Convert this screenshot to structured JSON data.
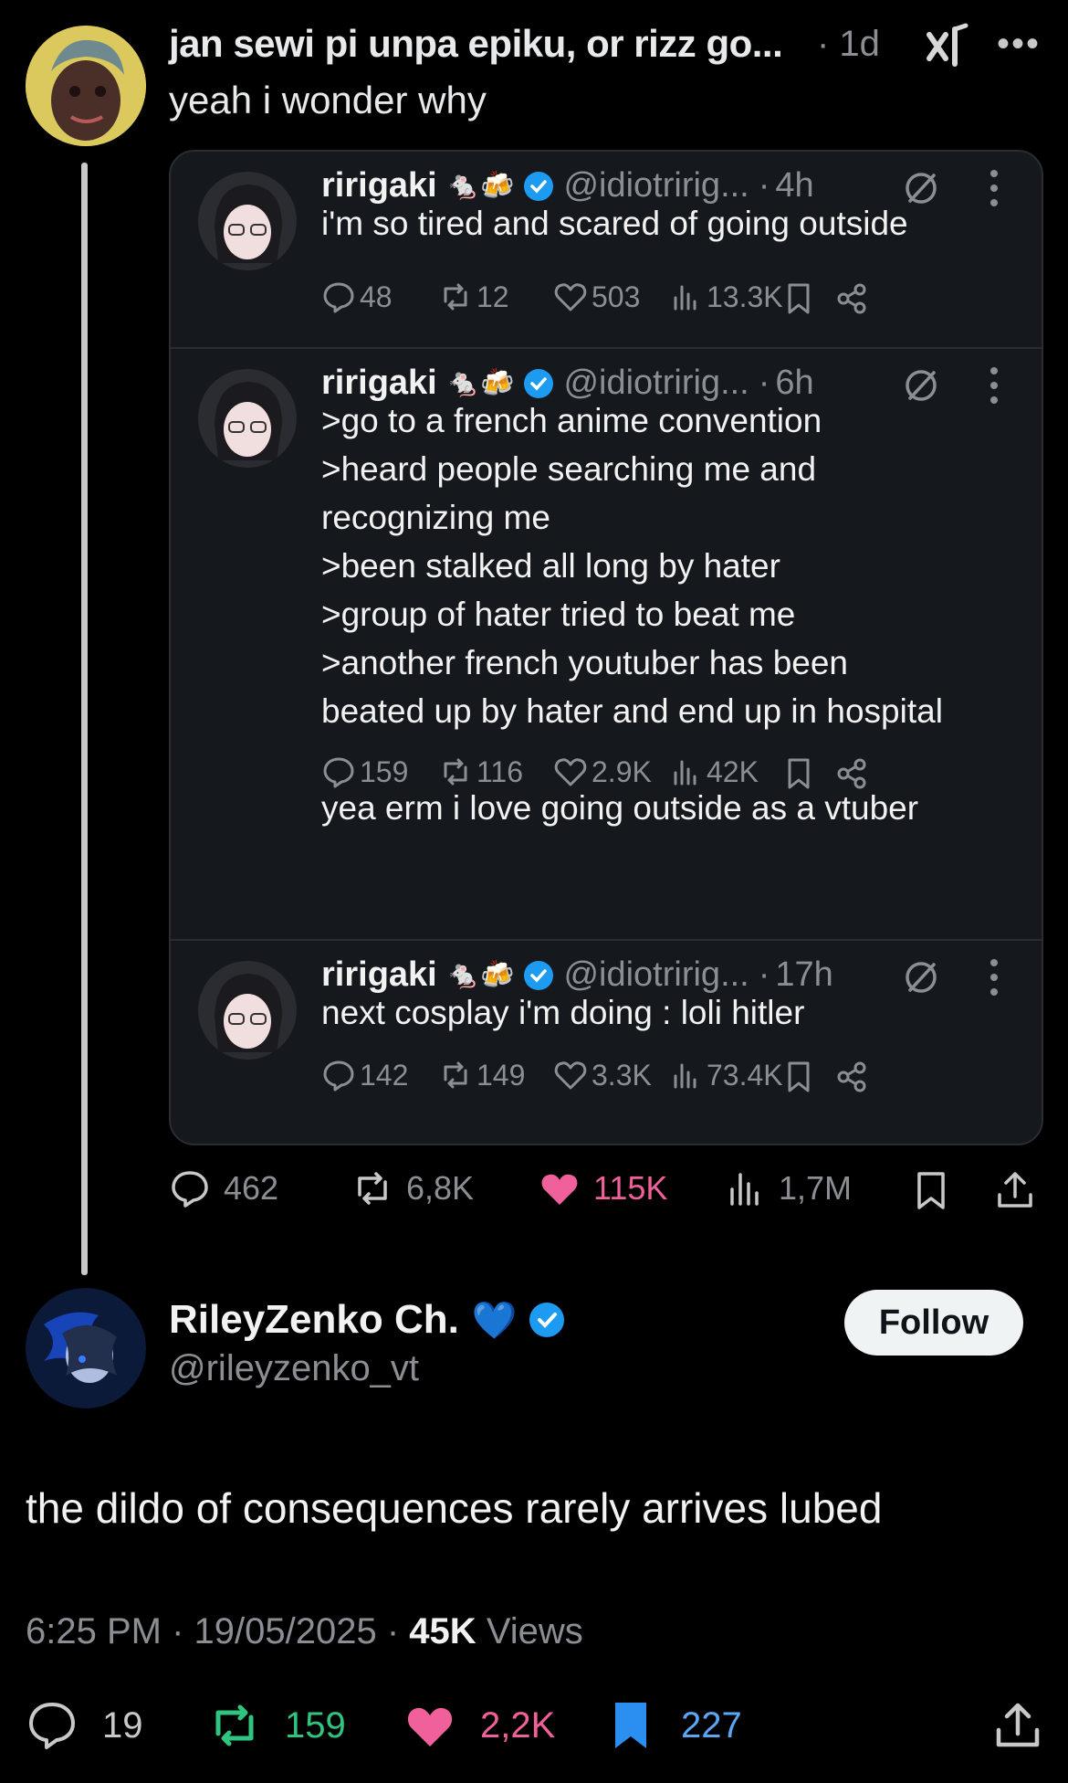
{
  "parent": {
    "author": "jan sewi pi unpa epiku, or rizz go...",
    "time": "· 1d",
    "text": "yeah i wonder why",
    "icons": [
      "grok-icon",
      "more-icon"
    ]
  },
  "quoted_posts": [
    {
      "name": "ririgaki",
      "emoji": "🐁🍻",
      "handle": "@idiotririg...",
      "time": "4h",
      "text": "i'm so tired and scared of going outside",
      "replies": "48",
      "reposts": "12",
      "likes": "503",
      "views": "13.3K"
    },
    {
      "name": "ririgaki",
      "emoji": "🐁🍻",
      "handle": "@idiotririg...",
      "time": "6h",
      "text": ">go to a french anime convention\n>heard people searching me and\nrecognizing me\n>been stalked all long by hater\n>group of hater tried to beat me\n>another french youtuber has been\nbeated up by hater and end up in hospital\n\nyea erm i love going outside as a vtuber",
      "replies": "159",
      "reposts": "116",
      "likes": "2.9K",
      "views": "42K"
    },
    {
      "name": "ririgaki",
      "emoji": "🐁🍻",
      "handle": "@idiotririg...",
      "time": "17h",
      "text": "next cosplay i'm doing : loli hitler",
      "replies": "142",
      "reposts": "149",
      "likes": "3.3K",
      "views": "73.4K"
    }
  ],
  "parent_stats": {
    "replies": "462",
    "reposts": "6,8K",
    "likes": "115K",
    "views": "1,7M"
  },
  "reply": {
    "author": "RileyZenko Ch.",
    "heart_emoji": "💙",
    "handle": "@rileyzenko_vt",
    "follow_label": "Follow",
    "text": "the dildo of consequences rarely arrives lubed",
    "time": "6:25 PM",
    "date": "19/05/2025",
    "views": "45K",
    "views_label": "Views",
    "stats": {
      "replies": "19",
      "reposts": "159",
      "likes": "2,2K",
      "bookmarks": "227"
    }
  },
  "colors": {
    "like": "#f0609a",
    "repost": "#2fc47f",
    "bookmark": "#2a8ff0",
    "verified": "#1d9bf0"
  }
}
